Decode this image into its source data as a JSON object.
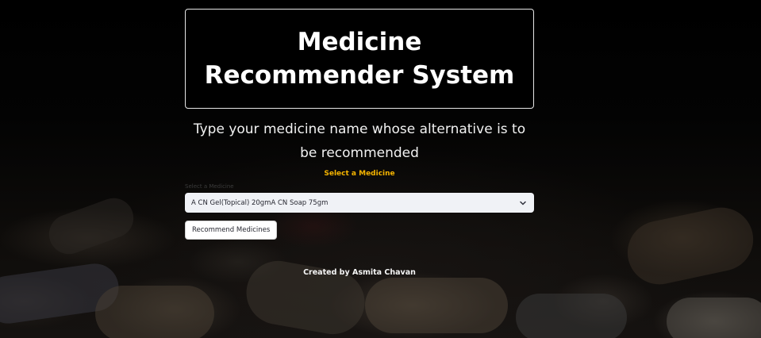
{
  "title": "Medicine Recommender System",
  "subtitle": "Type your medicine name whose alternative is to be recommended",
  "select_heading": "Select a Medicine",
  "select": {
    "label": "Select a Medicine",
    "value": "A CN Gel(Topical) 20gmA CN Soap 75gm",
    "icon": "chevron-down-icon"
  },
  "button": {
    "label": "Recommend Medicines"
  },
  "footer": "Created by Asmita Chavan",
  "colors": {
    "heading_accent": "#f5b400",
    "select_bg": "#f0f2f6",
    "page_bg": "#000000"
  }
}
